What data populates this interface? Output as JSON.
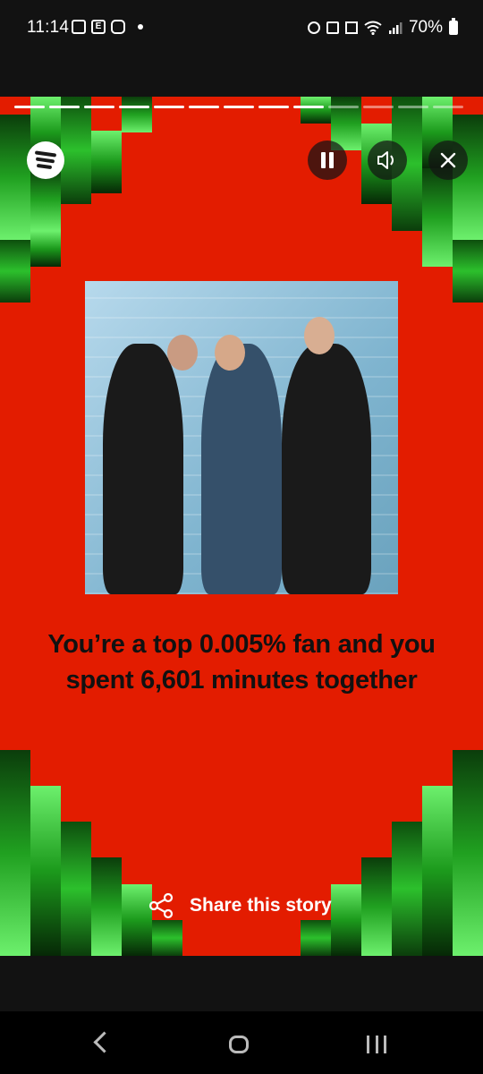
{
  "status_bar": {
    "time": "11:14",
    "battery": "70%"
  },
  "story": {
    "progress": {
      "total_segments": 13,
      "completed_segments": 9
    },
    "headline": "You’re a top 0.005% fan and you spent 6,601 minutes together",
    "share_label": "Share this story",
    "colors": {
      "background": "#e31c00",
      "tile_green": "#2cc02c",
      "text": "#111111"
    }
  },
  "icons": {
    "spotify": "spotify-logo-icon",
    "pause": "pause-icon",
    "sound": "speaker-icon",
    "close": "close-icon",
    "share": "share-icon"
  }
}
